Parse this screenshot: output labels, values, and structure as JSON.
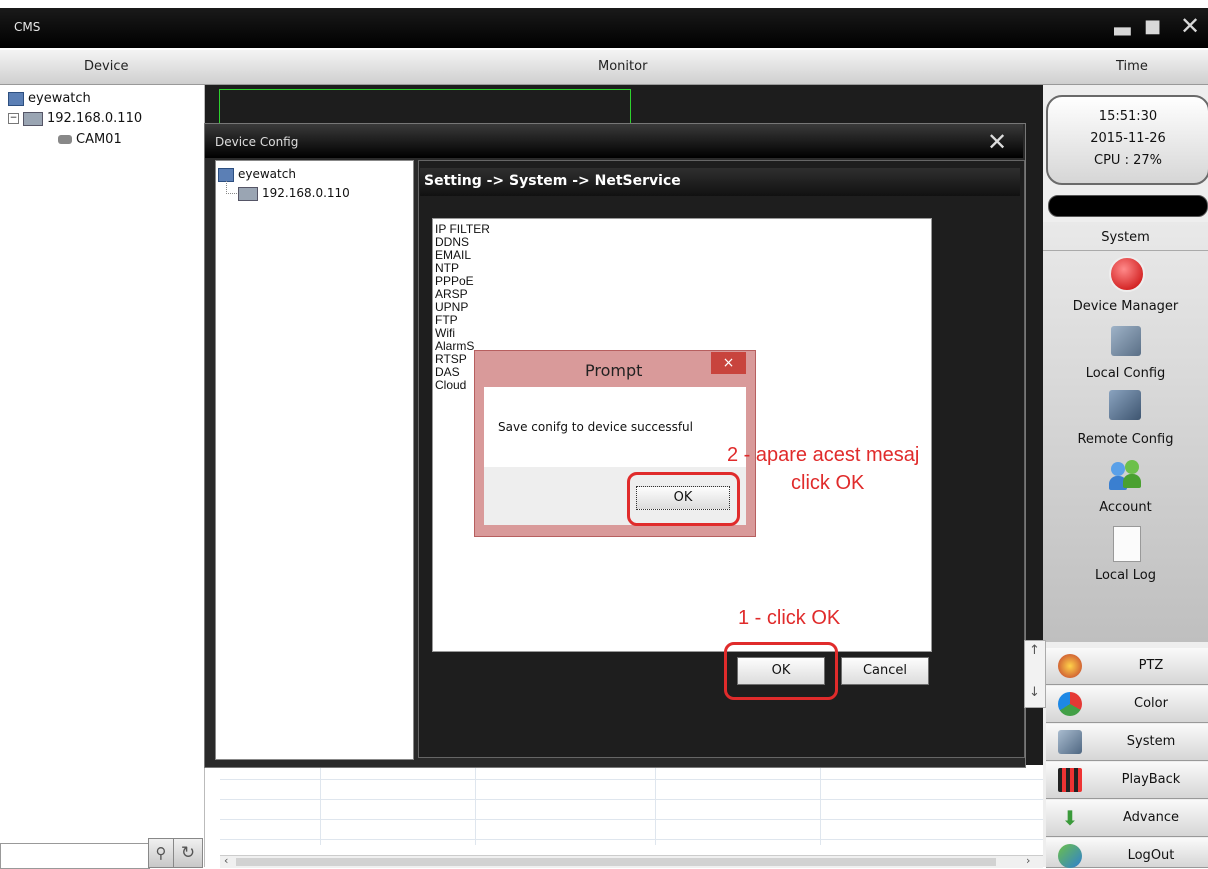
{
  "window": {
    "title": "CMS"
  },
  "columns": {
    "device": "Device",
    "monitor": "Monitor",
    "time": "Time"
  },
  "device_tree": {
    "root": "eyewatch",
    "device": "192.168.0.110",
    "camera": "CAM01"
  },
  "clock": {
    "time": "15:51:30",
    "date": "2015-11-26",
    "cpu": "CPU : 27%"
  },
  "right_panel": {
    "section": "System",
    "items": [
      "Device Manager",
      "Local Config",
      "Remote Config",
      "Account",
      "Local Log"
    ],
    "buttons": [
      "PTZ",
      "Color",
      "System",
      "PlayBack",
      "Advance",
      "LogOut"
    ]
  },
  "device_config": {
    "title": "Device Config",
    "tree_root": "eyewatch",
    "tree_device": "192.168.0.110",
    "breadcrumb": "Setting -> System -> NetService",
    "services": [
      "IP FILTER",
      "DDNS",
      "EMAIL",
      "NTP",
      "PPPoE",
      "ARSP",
      "UPNP",
      "FTP",
      "Wifi",
      "AlarmS",
      "RTSP",
      "DAS",
      "Cloud"
    ],
    "ok_label": "OK",
    "cancel_label": "Cancel"
  },
  "prompt": {
    "title": "Prompt",
    "close": "×",
    "message": "Save conifg to device successful",
    "ok_label": "OK"
  },
  "annotations": {
    "step2_line1": "2 - apare acest mesaj",
    "step2_line2": "click OK",
    "step1": "1 - click OK"
  },
  "colors": {
    "annotation": "#e02b2b",
    "prompt_frame": "#d99a9a",
    "close_red": "#c8443d"
  }
}
